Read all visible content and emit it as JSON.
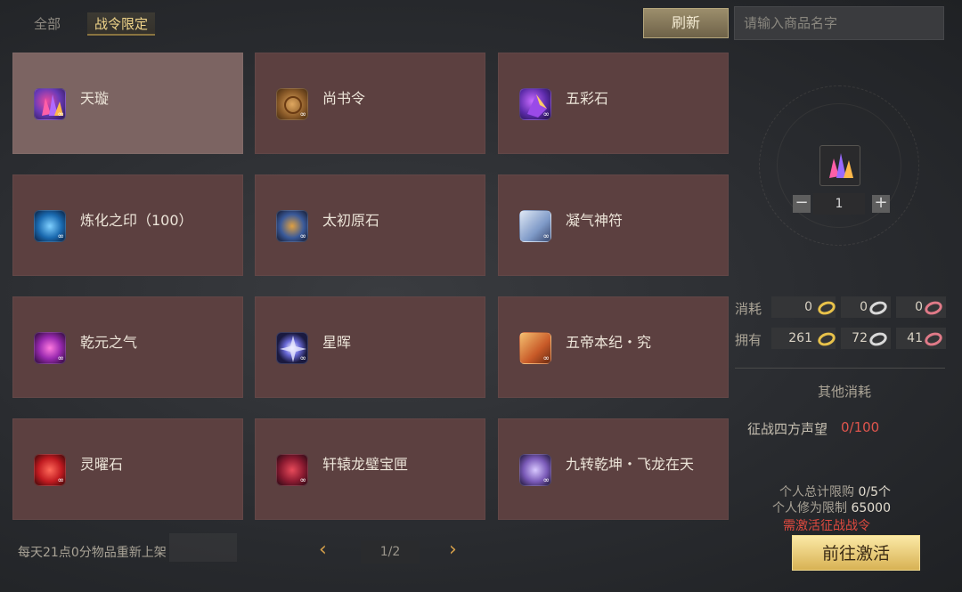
{
  "tabs": {
    "all": "全部",
    "limited": "战令限定"
  },
  "toolbar": {
    "refresh_label": "刷新",
    "search_placeholder": "请输入商品名字"
  },
  "items": [
    {
      "name": "天璇",
      "icon": "crystal-cluster-icon"
    },
    {
      "name": "尚书令",
      "icon": "scroll-seal-icon"
    },
    {
      "name": "五彩石",
      "icon": "colored-stone-icon"
    },
    {
      "name": "炼化之印（100）",
      "icon": "blue-orb-icon"
    },
    {
      "name": "太初原石",
      "icon": "raw-ore-icon"
    },
    {
      "name": "凝气神符",
      "icon": "talisman-paper-icon"
    },
    {
      "name": "乾元之气",
      "icon": "purple-aura-icon"
    },
    {
      "name": "星晖",
      "icon": "star-burst-icon"
    },
    {
      "name": "五帝本纪・究",
      "icon": "book-icon"
    },
    {
      "name": "灵曜石",
      "icon": "red-spiral-stone-icon"
    },
    {
      "name": "轩辕龙璧宝匣",
      "icon": "red-jade-box-icon"
    },
    {
      "name": "九转乾坤・飞龙在天",
      "icon": "dragon-orb-icon"
    }
  ],
  "infinity_mark": "∞",
  "detail": {
    "quantity": "1",
    "minus": "−",
    "plus": "+",
    "cost_label": "消耗",
    "own_label": "拥有",
    "cost_values": [
      "0",
      "0",
      "0"
    ],
    "own_values": [
      "261",
      "72",
      "41"
    ],
    "coin_colors": [
      "#e8c24a",
      "#d9d9d9",
      "#e07a88"
    ],
    "other_cost_title": "其他消耗",
    "reputation_label": "征战四方声望",
    "reputation_value": "0/100",
    "personal_limit_label": "个人总计限购",
    "personal_limit_value": "0/5个",
    "cultivation_limit_label": "个人修为限制",
    "cultivation_limit_value": "65000",
    "need_activate": "需激活征战战令",
    "activate_button": "前往激活"
  },
  "footer": {
    "restock_note": "每天21点0分物品重新上架",
    "page": "1/2"
  }
}
